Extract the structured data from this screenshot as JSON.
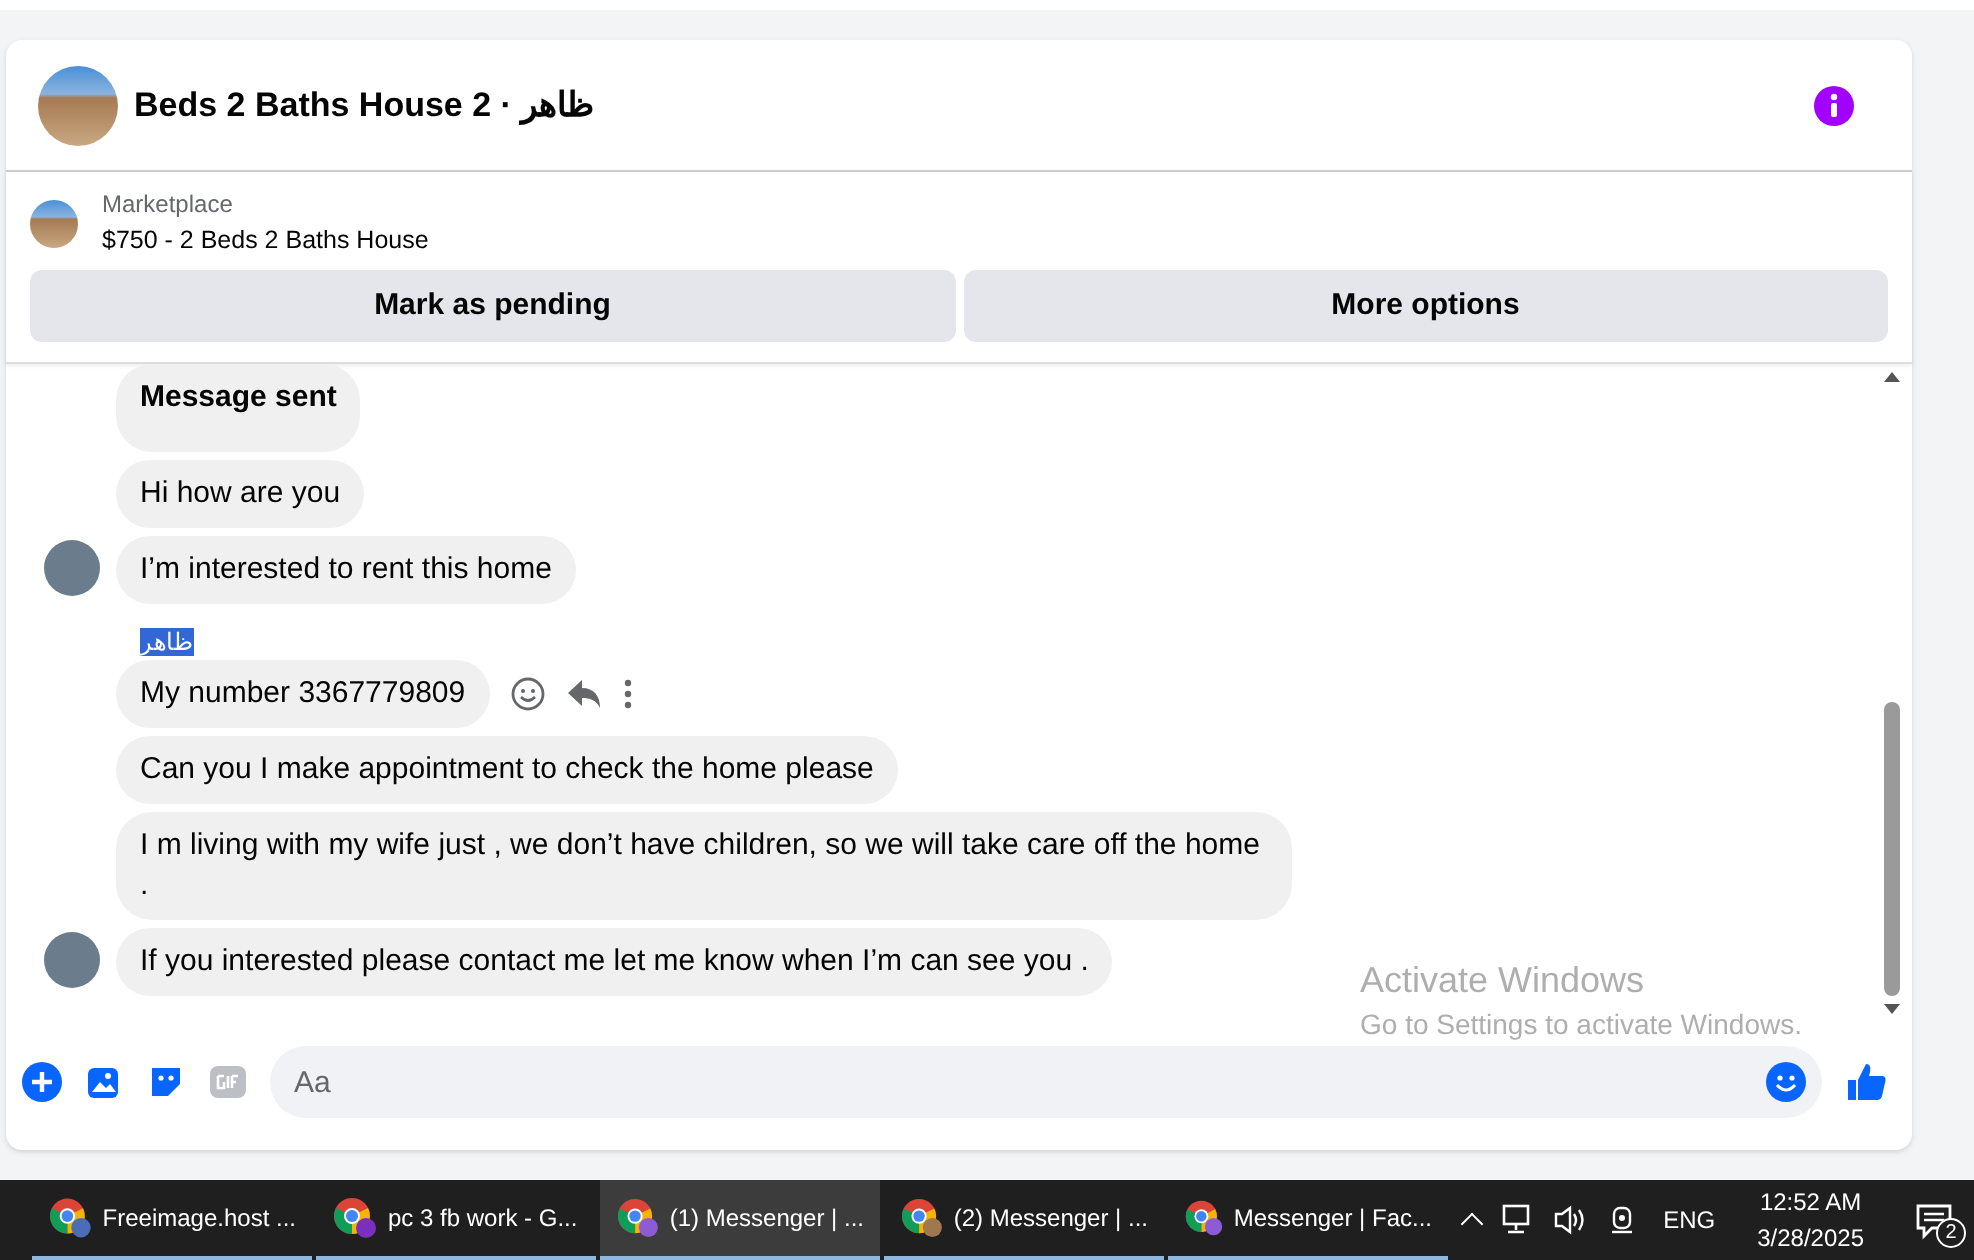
{
  "conversation": {
    "title": "Beds 2 Baths House 2 · ظاهر"
  },
  "listing": {
    "source": "Marketplace",
    "title": "$750 - 2 Beds 2 Baths House"
  },
  "actions": [
    "Mark as pending",
    "More options"
  ],
  "messages": [
    {
      "kind": "status",
      "text": "Message sent",
      "avatar": false,
      "actions": false
    },
    {
      "kind": "text",
      "text": "Hi how are you",
      "avatar": false,
      "actions": false
    },
    {
      "kind": "text",
      "text": "I’m interested to rent this home",
      "avatar": true,
      "actions": false
    },
    {
      "kind": "sender",
      "text": "ظاهر",
      "highlighted": true
    },
    {
      "kind": "text",
      "text": "My number 3367779809",
      "avatar": false,
      "actions": true
    },
    {
      "kind": "text",
      "text": "Can you I make appointment to check the home please",
      "avatar": false,
      "actions": false
    },
    {
      "kind": "text",
      "text": "I m living with my wife just , we don’t have children, so we will take care off the home .",
      "avatar": false,
      "actions": false
    },
    {
      "kind": "text",
      "text": "If you interested please contact me let me know when I’m can see you .",
      "avatar": true,
      "actions": false
    }
  ],
  "composer": {
    "placeholder": "Aa"
  },
  "activation_notice": {
    "title": "Activate Windows",
    "detail": "Go to Settings to activate Windows."
  },
  "taskbar": {
    "items": [
      {
        "label": "Freeimage.host ...",
        "selected": false
      },
      {
        "label": "pc 3 fb work - G...",
        "selected": false
      },
      {
        "label": "(1) Messenger | ...",
        "selected": true
      },
      {
        "label": "(2) Messenger | ...",
        "selected": false
      },
      {
        "label": "Messenger | Fac...",
        "selected": false
      }
    ],
    "language": "ENG",
    "time": "12:52 AM",
    "date": "3/28/2025",
    "notification_count": "2"
  }
}
